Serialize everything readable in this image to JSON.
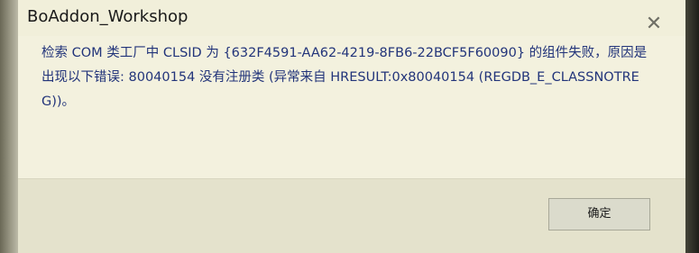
{
  "dialog": {
    "title": "BoAddon_Workshop",
    "close_glyph": "✕",
    "close_icon": "close-icon",
    "message": "检索 COM 类工厂中 CLSID 为 {632F4591-AA62-4219-8FB6-22BCF5F60090} 的组件失败，原因是出现以下错误: 80040154 没有注册类 (异常来自 HRESULT:0x80040154 (REGDB_E_CLASSNOTREG))。",
    "ok_label": "确定"
  }
}
